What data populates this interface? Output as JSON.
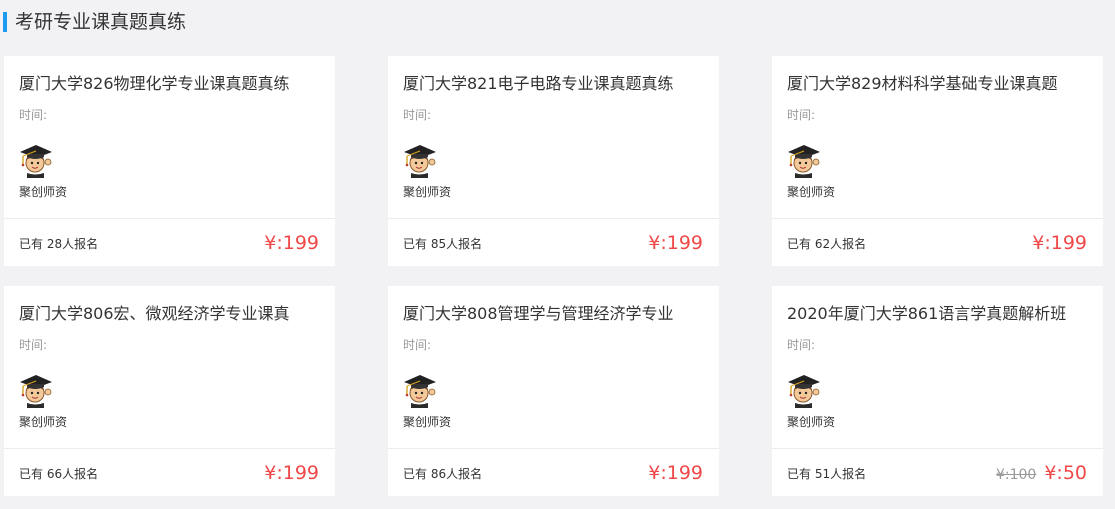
{
  "section": {
    "title": "考研专业课真题真练"
  },
  "labels": {
    "time": "时间:",
    "teacher": "聚创师资"
  },
  "colors": {
    "accent": "#1e9bf0",
    "price": "#f04848"
  },
  "courses": [
    {
      "title": "厦门大学826物理化学专业课真题真练",
      "enrolled": "已有 28人报名",
      "price": "¥:199"
    },
    {
      "title": "厦门大学821电子电路专业课真题真练",
      "enrolled": "已有 85人报名",
      "price": "¥:199"
    },
    {
      "title": "厦门大学829材料科学基础专业课真题",
      "enrolled": "已有 62人报名",
      "price": "¥:199"
    },
    {
      "title": "厦门大学806宏、微观经济学专业课真",
      "enrolled": "已有 66人报名",
      "price": "¥:199"
    },
    {
      "title": "厦门大学808管理学与管理经济学专业",
      "enrolled": "已有 86人报名",
      "price": "¥:199"
    },
    {
      "title": "2020年厦门大学861语言学真题解析班",
      "enrolled": "已有 51人报名",
      "price": "¥:50",
      "original_price": "¥:100"
    }
  ],
  "icons": {
    "avatar": "graduate-cap-avatar-icon"
  }
}
